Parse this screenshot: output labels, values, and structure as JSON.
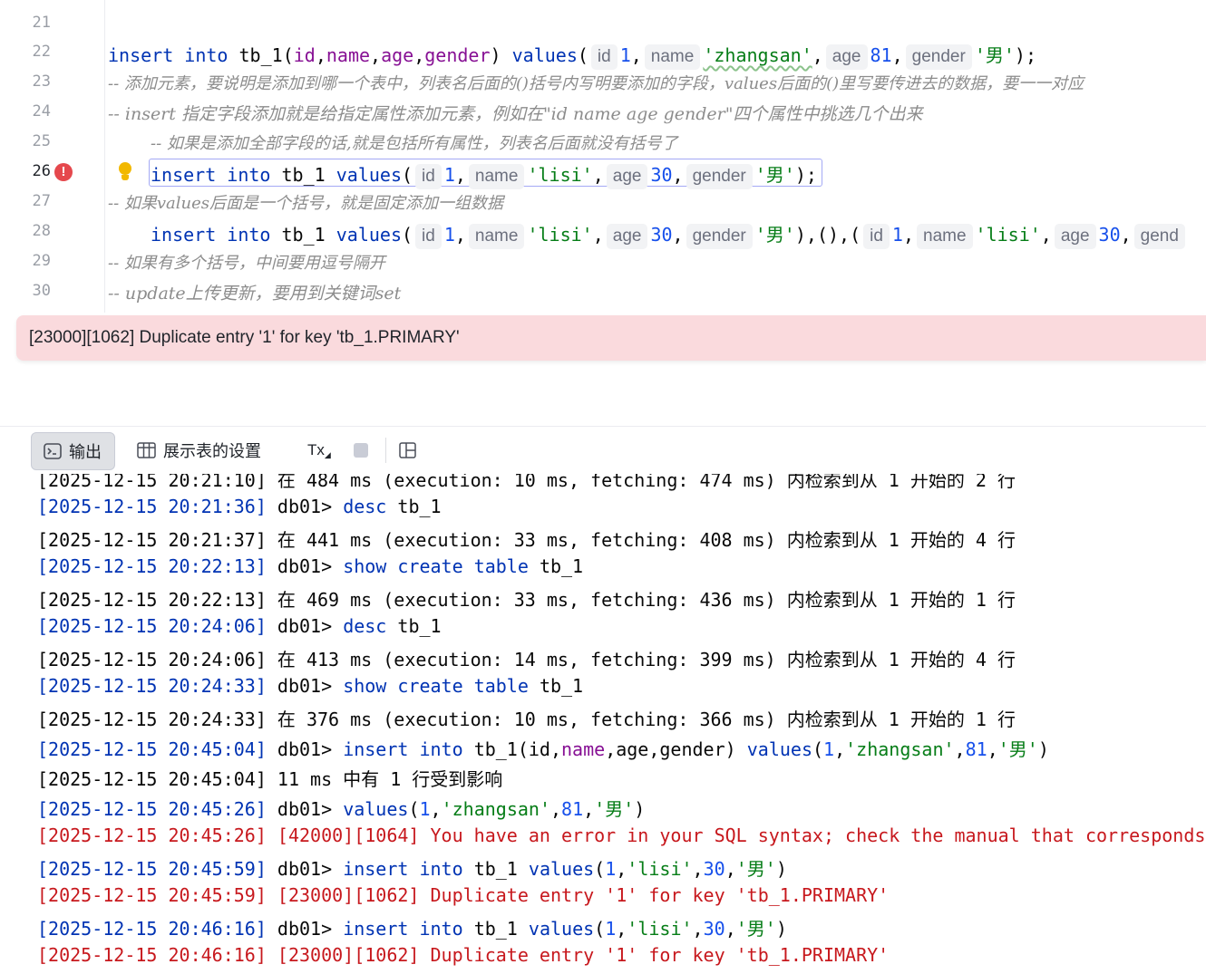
{
  "editor": {
    "line_numbers": [
      "21",
      "22",
      "23",
      "24",
      "25",
      "26",
      "27",
      "28",
      "29",
      "30"
    ],
    "line22": {
      "kw1": "insert",
      "kw2": "into",
      "table": "tb_1",
      "open": "(",
      "f1": "id",
      "c1": ",",
      "f2": "name",
      "c2": ",",
      "f3": "age",
      "c3": ",",
      "f4": "gender",
      "close": ")",
      "kw3": "values",
      "paren": "(",
      "h1": "id",
      "v1": "1",
      "s1": ",",
      "h2": "name",
      "v2": "'zhangsan'",
      "s2": ",",
      "h3": "age",
      "v3": "81",
      "s3": ",",
      "h4": "gender",
      "v4": "'男'",
      "end": ");"
    },
    "line23": "-- 添加元素，要说明是添加到哪一个表中，列表名后面的()括号内写明要添加的字段，values后面的()里写要传进去的数据，要一一对应",
    "line24": "-- insert 指定字段添加就是给指定属性添加元素，例如在\"id name age gender\"四个属性中挑选几个出来",
    "line25": "-- 如果是添加全部字段的话,就是包括所有属性，列表名后面就没有括号了",
    "line26": {
      "kw1": "insert",
      "kw2": "into",
      "table": "tb_1",
      "kw3": "values",
      "paren": "(",
      "h1": "id",
      "v1": "1",
      "s1": ",",
      "h2": "name",
      "v2": "'lisi'",
      "s2": ",",
      "h3": "age",
      "v3": "30",
      "s3": ",",
      "h4": "gender",
      "v4": "'男'",
      "close": ")",
      "end": ";"
    },
    "line27": "-- 如果values后面是一个括号，就是固定添加一组数据",
    "line28": {
      "kw1": "insert",
      "kw2": "into",
      "table": "tb_1",
      "kw3": "values",
      "paren": "(",
      "h1": "id",
      "v1": "1",
      "s1": ",",
      "h2": "name",
      "v2": "'lisi'",
      "s2": ",",
      "h3": "age",
      "v3": "30",
      "s3": ",",
      "h4": "gender",
      "v4": "'男'",
      "mid": "),(),(",
      "h5": "id",
      "v5": "1",
      "s5": ",",
      "h6": "name",
      "v6": "'lisi'",
      "s6": ",",
      "h7": "age",
      "v7": "30",
      "s7": ",",
      "h8": "gend"
    },
    "line29": "-- 如果有多个括号，中间要用逗号隔开",
    "line30": "-- update上传更新，要用到关键词set",
    "error_message": "[23000][1062] Duplicate entry '1' for key 'tb_1.PRIMARY'"
  },
  "toolbar": {
    "output_label": "输出",
    "table_settings_label": "展示表的设置",
    "tx_label": "Tx"
  },
  "console": {
    "l0": {
      "ts": "[2025-12-15 20:21:10]",
      "text": "在 484 ms (execution: 10 ms, fetching: 474 ms) 内检索到从 1 开始的 2 行"
    },
    "l1": {
      "ts": "[2025-12-15 20:21:36]",
      "prompt": "db01>",
      "kw": "desc",
      "rest": "tb_1"
    },
    "l2": {
      "ts": "[2025-12-15 20:21:37]",
      "text": "在 441 ms (execution: 33 ms, fetching: 408 ms) 内检索到从 1 开始的 4 行"
    },
    "l3": {
      "ts": "[2025-12-15 20:22:13]",
      "prompt": "db01>",
      "kw": "show create table",
      "rest": "tb_1"
    },
    "l4": {
      "ts": "[2025-12-15 20:22:13]",
      "text": "在 469 ms (execution: 33 ms, fetching: 436 ms) 内检索到从 1 开始的 1 行"
    },
    "l5": {
      "ts": "[2025-12-15 20:24:06]",
      "prompt": "db01>",
      "kw": "desc",
      "rest": "tb_1"
    },
    "l6": {
      "ts": "[2025-12-15 20:24:06]",
      "text": "在 413 ms (execution: 14 ms, fetching: 399 ms) 内检索到从 1 开始的 4 行"
    },
    "l7": {
      "ts": "[2025-12-15 20:24:33]",
      "prompt": "db01>",
      "kw": "show create table",
      "rest": "tb_1"
    },
    "l8": {
      "ts": "[2025-12-15 20:24:33]",
      "text": "在 376 ms (execution: 10 ms, fetching: 366 ms) 内检索到从 1 开始的 1 行"
    },
    "l9": {
      "ts": "[2025-12-15 20:45:04]",
      "prompt": "db01>",
      "kw1": "insert into",
      "tbl": "tb_1(id,",
      "fld": "name",
      "cols": ",age,gender)",
      "kw2": "values",
      "p": "(",
      "n1": "1",
      "c1": ",",
      "s1": "'zhangsan'",
      "c2": ",",
      "n2": "81",
      "c3": ",",
      "s2": "'男'",
      "e": ")"
    },
    "l10": {
      "ts": "[2025-12-15 20:45:04]",
      "text": "11 ms 中有 1 行受到影响"
    },
    "l11": {
      "ts": "[2025-12-15 20:45:26]",
      "prompt": "db01>",
      "kw": "values",
      "p": "(",
      "n1": "1",
      "c1": ",",
      "s1": "'zhangsan'",
      "c2": ",",
      "n2": "81",
      "c3": ",",
      "s2": "'男'",
      "e": ")"
    },
    "l12": {
      "ts": "[2025-12-15 20:45:26]",
      "text": "[42000][1064] You have an error in your SQL syntax; check the manual that corresponds"
    },
    "l13": {
      "ts": "[2025-12-15 20:45:59]",
      "prompt": "db01>",
      "kw1": "insert into",
      "tbl": "tb_1",
      "kw2": "values",
      "p": "(",
      "n1": "1",
      "c1": ",",
      "s1": "'lisi'",
      "c2": ",",
      "n2": "30",
      "c3": ",",
      "s2": "'男'",
      "e": ")"
    },
    "l14": {
      "ts": "[2025-12-15 20:45:59]",
      "text": "[23000][1062] Duplicate entry '1' for key 'tb_1.PRIMARY'"
    },
    "l15": {
      "ts": "[2025-12-15 20:46:16]",
      "prompt": "db01>",
      "kw1": "insert into",
      "tbl": "tb_1",
      "kw2": "values",
      "p": "(",
      "n1": "1",
      "c1": ",",
      "s1": "'lisi'",
      "c2": ",",
      "n2": "30",
      "c3": ",",
      "s2": "'男'",
      "e": ")"
    },
    "l16": {
      "ts": "[2025-12-15 20:46:16]",
      "text": "[23000][1062] Duplicate entry '1' for key 'tb_1.PRIMARY'"
    }
  },
  "colors": {
    "keyword": "#0033b3",
    "string": "#067d17",
    "number": "#1750eb",
    "field": "#871094",
    "comment": "#8c8c8c",
    "error_text": "#c7181d",
    "error_bar": "#fadadd"
  },
  "icons": [
    "error-icon",
    "bulb-icon",
    "terminal-icon",
    "table-icon",
    "stop-icon",
    "layout-icon"
  ]
}
